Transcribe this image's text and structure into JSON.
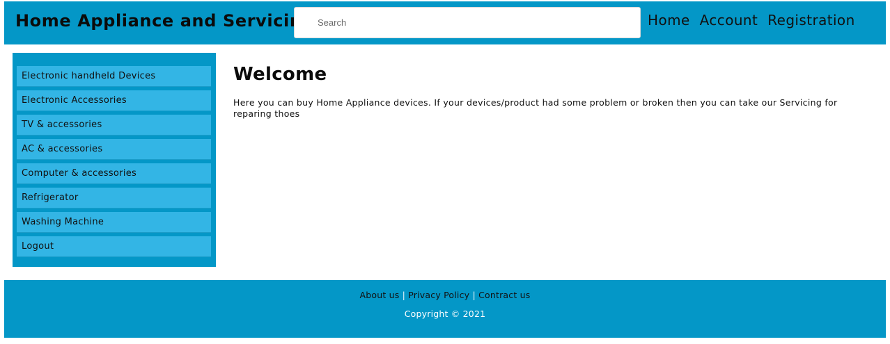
{
  "header": {
    "title": "Home Appliance and Servicing",
    "search": {
      "placeholder": "Search",
      "value": ""
    },
    "nav": [
      {
        "label": "Home"
      },
      {
        "label": "Account"
      },
      {
        "label": "Registration"
      }
    ]
  },
  "sidebar": {
    "items": [
      {
        "label": "Electronic handheld Devices"
      },
      {
        "label": "Electronic Accessories"
      },
      {
        "label": "TV & accessories"
      },
      {
        "label": "AC & accessories"
      },
      {
        "label": "Computer & accessories"
      },
      {
        "label": "Refrigerator"
      },
      {
        "label": "Washing Machine"
      },
      {
        "label": "Logout"
      }
    ]
  },
  "main": {
    "heading": "Welcome",
    "text": "Here you can buy Home Appliance devices. If your devices/product had some problem or broken then you can take our Servicing for reparing thoes"
  },
  "footer": {
    "links": [
      {
        "label": "About us"
      },
      {
        "label": "Privacy Policy"
      },
      {
        "label": "Contract us"
      }
    ],
    "separator": "|",
    "copyright": "Copyright © 2021"
  },
  "colors": {
    "brand_blue": "#0497c7",
    "sidebar_item": "#33b5e5"
  }
}
